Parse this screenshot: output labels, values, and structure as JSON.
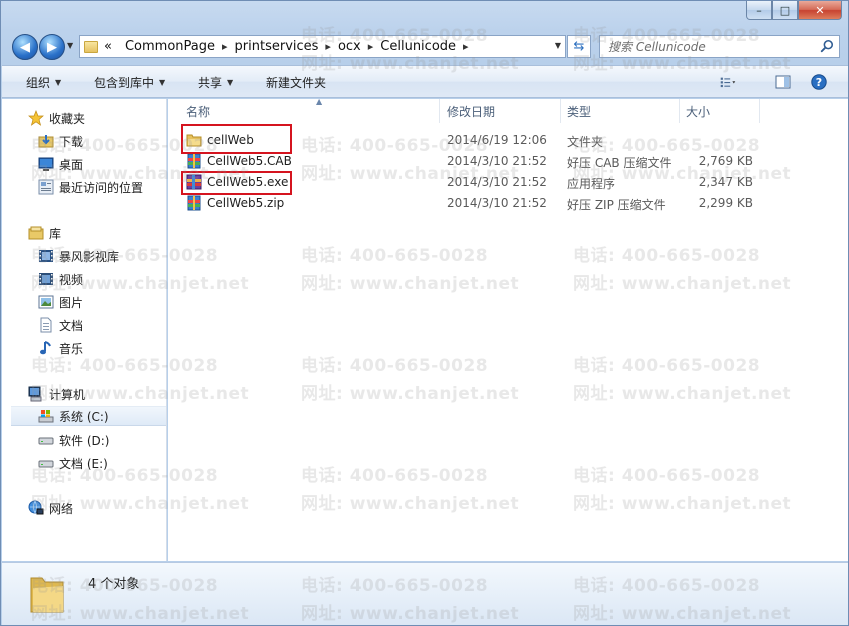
{
  "window": {
    "caption": {
      "minimize": "–",
      "maximize": "□",
      "close": "✕"
    }
  },
  "address_bar": {
    "overflow": "«",
    "crumbs": [
      "CommonPage",
      "printservices",
      "ocx",
      "Cellunicode"
    ]
  },
  "search": {
    "placeholder": "搜索 Cellunicode"
  },
  "toolbar": {
    "organize": "组织",
    "include_in_library": "包含到库中",
    "share": "共享",
    "new_folder": "新建文件夹"
  },
  "sidebar": {
    "favorites": {
      "label": "收藏夹",
      "items": [
        "下载",
        "桌面",
        "最近访问的位置"
      ]
    },
    "libraries": {
      "label": "库",
      "items": [
        "暴风影视库",
        "视频",
        "图片",
        "文档",
        "音乐"
      ]
    },
    "computer": {
      "label": "计算机",
      "items": [
        "系统 (C:)",
        "软件 (D:)",
        "文档 (E:)"
      ]
    },
    "network": {
      "label": "网络"
    }
  },
  "columns": {
    "name": "名称",
    "modified": "修改日期",
    "type": "类型",
    "size": "大小"
  },
  "files": [
    {
      "name": "cellWeb",
      "modified": "2014/6/19 12:06",
      "type": "文件夹",
      "size": "",
      "icon": "folder-icon"
    },
    {
      "name": "CellWeb5.CAB",
      "modified": "2014/3/10 21:52",
      "type": "好压 CAB 压缩文件",
      "size": "2,769 KB",
      "icon": "archive-icon"
    },
    {
      "name": "CellWeb5.exe",
      "modified": "2014/3/10 21:52",
      "type": "应用程序",
      "size": "2,347 KB",
      "icon": "exe-icon"
    },
    {
      "name": "CellWeb5.zip",
      "modified": "2014/3/10 21:52",
      "type": "好压 ZIP 压缩文件",
      "size": "2,299 KB",
      "icon": "archive-icon"
    }
  ],
  "status": {
    "count": "4 个对象"
  },
  "watermark": {
    "phone": "电话: 400-665-0028",
    "site": "网址: www.chanjet.net"
  },
  "colors": {
    "highlight": "#d5141f",
    "accent": "#2a71c9"
  }
}
